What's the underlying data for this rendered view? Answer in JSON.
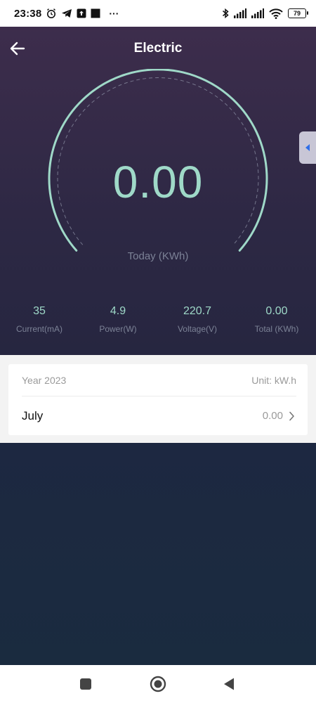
{
  "status_bar": {
    "time": "23:38",
    "left_icons": [
      "alarm-icon",
      "telegram-icon",
      "upload-icon",
      "square-icon",
      "more-dots-icon"
    ],
    "more_dots": "···",
    "right_icons": [
      "bluetooth-icon",
      "signal-icon",
      "signal-icon",
      "wifi-icon",
      "battery-icon"
    ],
    "battery_level": "79"
  },
  "header": {
    "title": "Electric",
    "back_icon": "back-arrow-icon",
    "side_tab_icon": "caret-left-icon"
  },
  "gauge": {
    "value": "0.00",
    "label": "Today (KWh)",
    "arc_color": "#9fd9c8"
  },
  "stats": [
    {
      "value": "35",
      "label": "Current(mA)"
    },
    {
      "value": "4.9",
      "label": "Power(W)"
    },
    {
      "value": "220.7",
      "label": "Voltage(V)"
    },
    {
      "value": "0.00",
      "label": "Total (KWh)"
    }
  ],
  "history": {
    "year": "Year 2023",
    "unit": "Unit: kW.h",
    "rows": [
      {
        "month": "July",
        "value": "0.00"
      }
    ]
  },
  "nav_bar": {
    "buttons": [
      "recent-apps-icon",
      "home-icon",
      "back-icon"
    ]
  },
  "colors": {
    "accent": "#9fd9c8",
    "header_bg": "#3d2d4c",
    "body_bg": "#1b2a40",
    "side_tab_icon": "#2f6ee8"
  }
}
